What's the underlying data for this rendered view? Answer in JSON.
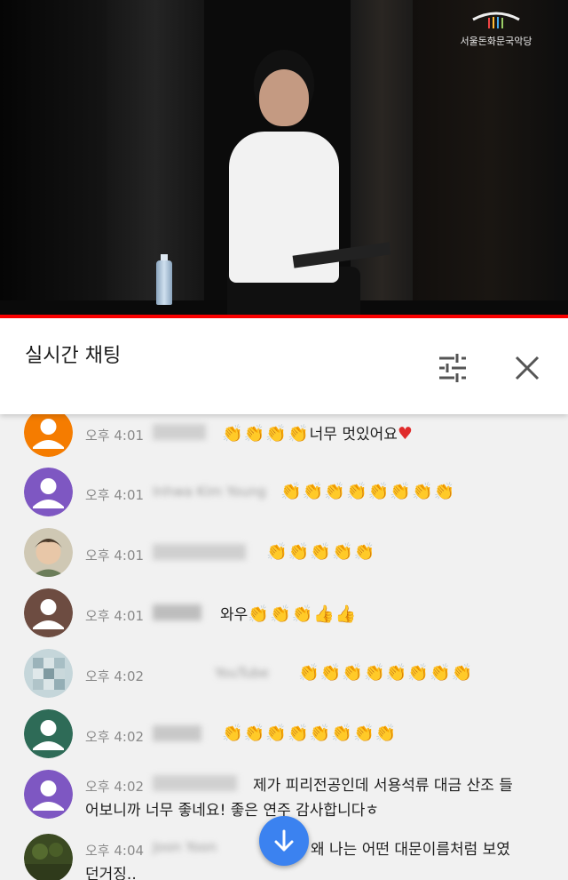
{
  "video": {
    "logo_text": "서울돈화문국악당"
  },
  "chat": {
    "title": "실시간 채팅",
    "messages": [
      {
        "time": "오후 4:01",
        "author": "",
        "text": "너무 멋있어요",
        "avatar_color": "#f57c00"
      },
      {
        "time": "오후 4:01",
        "author": "Inhwa Kim Young",
        "text": "",
        "avatar_color": "#7e57c2"
      },
      {
        "time": "오후 4:01",
        "author": "",
        "text": "",
        "avatar_color": "#9e8f6a"
      },
      {
        "time": "오후 4:01",
        "author": "",
        "text": "와우",
        "avatar_color": "#6d4c41"
      },
      {
        "time": "오후 4:02",
        "author": "YouTube",
        "text": "",
        "avatar_color": "#a9c2c9"
      },
      {
        "time": "오후 4:02",
        "author": "",
        "text": "",
        "avatar_color": "#2e6b57"
      },
      {
        "time": "오후 4:02",
        "author": "",
        "text": "제가 피리전공인데 서용석류 대금 산조 들",
        "text2": "어보니까 너무 좋네요! 좋은 연주 감사합니다ㅎ",
        "avatar_color": "#7e57c2"
      },
      {
        "time": "오후 4:04",
        "author": "Joon Yoon",
        "text": "왜 나는 어떤 대문이름처럼 보였",
        "text2": "던거징..",
        "avatar_color": "#3b4a22"
      }
    ]
  },
  "colors": {
    "accent_red": "#ff0000",
    "scroll_button": "#3b82f0"
  },
  "icons": {
    "filter": "tune-sliders-icon",
    "close": "close-icon",
    "scroll": "arrow-down-icon"
  }
}
